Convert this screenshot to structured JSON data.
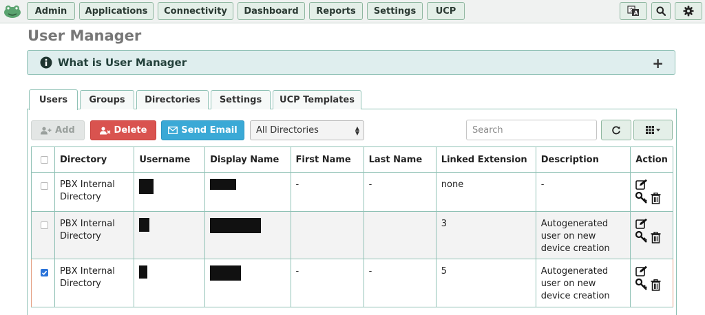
{
  "nav": {
    "items": [
      "Admin",
      "Applications",
      "Connectivity",
      "Dashboard",
      "Reports",
      "Settings",
      "UCP"
    ]
  },
  "page": {
    "title": "User Manager"
  },
  "info_panel": {
    "title": "What is User Manager",
    "toggle": "+"
  },
  "tabs": [
    "Users",
    "Groups",
    "Directories",
    "Settings",
    "UCP Templates"
  ],
  "active_tab": "Users",
  "toolbar": {
    "add_label": "Add",
    "delete_label": "Delete",
    "email_label": "Send Email",
    "directory_selected": "All Directories",
    "search_placeholder": "Search"
  },
  "table": {
    "columns": [
      "Directory",
      "Username",
      "Display Name",
      "First Name",
      "Last Name",
      "Linked Extension",
      "Description",
      "Action"
    ],
    "rows": [
      {
        "checked": false,
        "directory": "PBX Internal Directory",
        "first_name": "-",
        "last_name": "-",
        "linked_extension": "none",
        "description": "-"
      },
      {
        "checked": false,
        "directory": "PBX Internal Directory",
        "first_name": "",
        "last_name": "",
        "linked_extension": "3",
        "description": "Autogenerated user on new device creation"
      },
      {
        "checked": true,
        "directory": "PBX Internal Directory",
        "first_name": "-",
        "last_name": "-",
        "linked_extension": "5",
        "description": "Autogenerated user on new device creation"
      }
    ]
  },
  "colors": {
    "accent_border": "#8fc1b5",
    "delete": "#d9534f",
    "send_email": "#3aa9d6",
    "nav_bg": "#e4efe8"
  }
}
